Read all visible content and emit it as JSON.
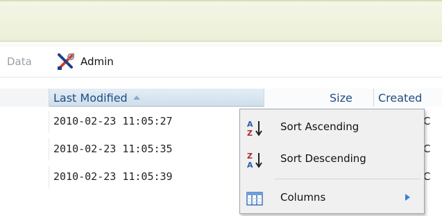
{
  "toolbar": {
    "data_label": "Data",
    "admin_label": "Admin"
  },
  "grid": {
    "columns": {
      "last_modified": "Last Modified",
      "size": "Size",
      "created": "Created"
    },
    "rows": [
      {
        "last_modified": "2010-02-23 11:05:27",
        "created": "C"
      },
      {
        "last_modified": "2010-02-23 11:05:35",
        "created": "C"
      },
      {
        "last_modified": "2010-02-23 11:05:39",
        "created": "C"
      }
    ]
  },
  "column_menu": {
    "sort_ascending": "Sort Ascending",
    "sort_descending": "Sort Descending",
    "columns": "Columns"
  },
  "colors": {
    "header_text": "#1f4c80",
    "banner": "#ecf0d8",
    "submenu_arrow": "#3a7fd5"
  }
}
